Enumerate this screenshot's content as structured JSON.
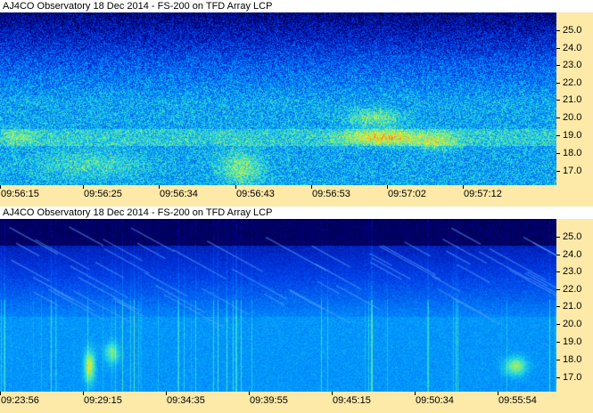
{
  "panels": [
    {
      "id": "top",
      "title": "AJ4CO Observatory 18 Dec 2014 - FS-200 on TFD Array LCP",
      "y_ticks": [
        "25.0",
        "24.0",
        "23.0",
        "22.0",
        "21.0",
        "20.0",
        "19.0",
        "18.0",
        "17.0"
      ],
      "x_ticks": [
        "09:56:15",
        "09:56:25",
        "09:56:34",
        "09:56:43",
        "09:56:53",
        "09:57:02",
        "09:57:12"
      ],
      "y_range_mhz": [
        16.4,
        25.6
      ],
      "style": "noisy-cyan"
    },
    {
      "id": "bottom",
      "title": "AJ4CO Observatory 18 Dec 2014 - FS-200 on TFD Array LCP",
      "y_ticks": [
        "25.0",
        "24.0",
        "23.0",
        "22.0",
        "21.0",
        "20.0",
        "19.0",
        "18.0",
        "17.0"
      ],
      "x_ticks": [
        "09:23:56",
        "09:29:15",
        "09:34:35",
        "09:39:55",
        "09:45:15",
        "09:50:34",
        "09:55:54"
      ],
      "y_range_mhz": [
        16.4,
        25.6
      ],
      "style": "deep-blue-bursts"
    }
  ],
  "colors": {
    "axis_background": "#fde9a8",
    "title_background": "#ffffff"
  }
}
